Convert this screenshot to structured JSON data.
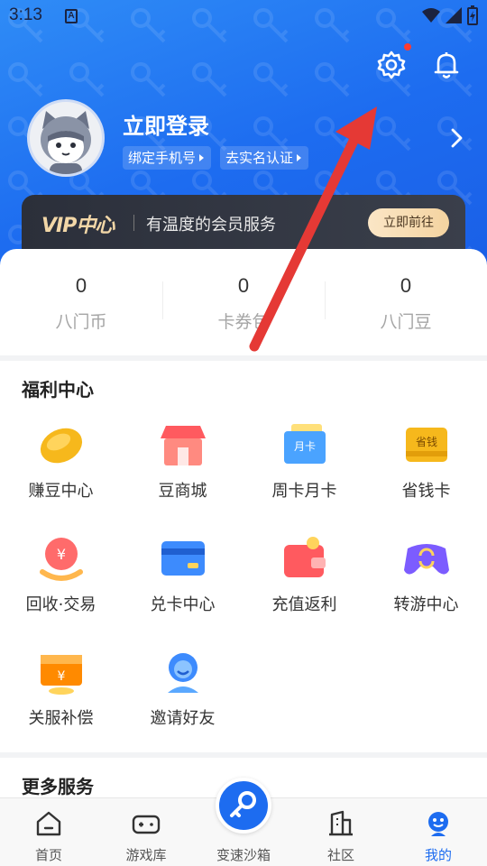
{
  "status_bar": {
    "time": "3:13",
    "badge": "A"
  },
  "profile": {
    "login_title": "立即登录",
    "bind_phone": "绑定手机号",
    "realname": "去实名认证"
  },
  "vip": {
    "logo": "VIP中心",
    "desc": "有温度的会员服务",
    "button": "立即前往"
  },
  "stats": [
    {
      "value": "0",
      "label": "八门币"
    },
    {
      "value": "0",
      "label": "卡券包"
    },
    {
      "value": "0",
      "label": "八门豆"
    }
  ],
  "welfare": {
    "title": "福利中心",
    "items": [
      {
        "label": "赚豆中心",
        "icon": "bean-icon"
      },
      {
        "label": "豆商城",
        "icon": "shop-icon"
      },
      {
        "label": "周卡月卡",
        "icon": "month-card-icon",
        "badge": "月卡"
      },
      {
        "label": "省钱卡",
        "icon": "save-card-icon",
        "badge": "省钱"
      },
      {
        "label": "回收·交易",
        "icon": "recycle-icon"
      },
      {
        "label": "兑卡中心",
        "icon": "card-exchange-icon"
      },
      {
        "label": "充值返利",
        "icon": "wallet-icon"
      },
      {
        "label": "转游中心",
        "icon": "gamepad-icon"
      },
      {
        "label": "关服补偿",
        "icon": "compensation-icon"
      },
      {
        "label": "邀请好友",
        "icon": "invite-icon"
      }
    ]
  },
  "more": {
    "title": "更多服务"
  },
  "tabs": [
    {
      "label": "首页",
      "icon": "home-icon"
    },
    {
      "label": "游戏库",
      "icon": "gamepad-icon"
    },
    {
      "label": "变速沙箱",
      "icon": "key-icon"
    },
    {
      "label": "社区",
      "icon": "community-icon"
    },
    {
      "label": "我的",
      "icon": "profile-icon",
      "active": true
    }
  ],
  "colors": {
    "brand": "#1d6cf0",
    "annotation_arrow": "#e53935"
  }
}
